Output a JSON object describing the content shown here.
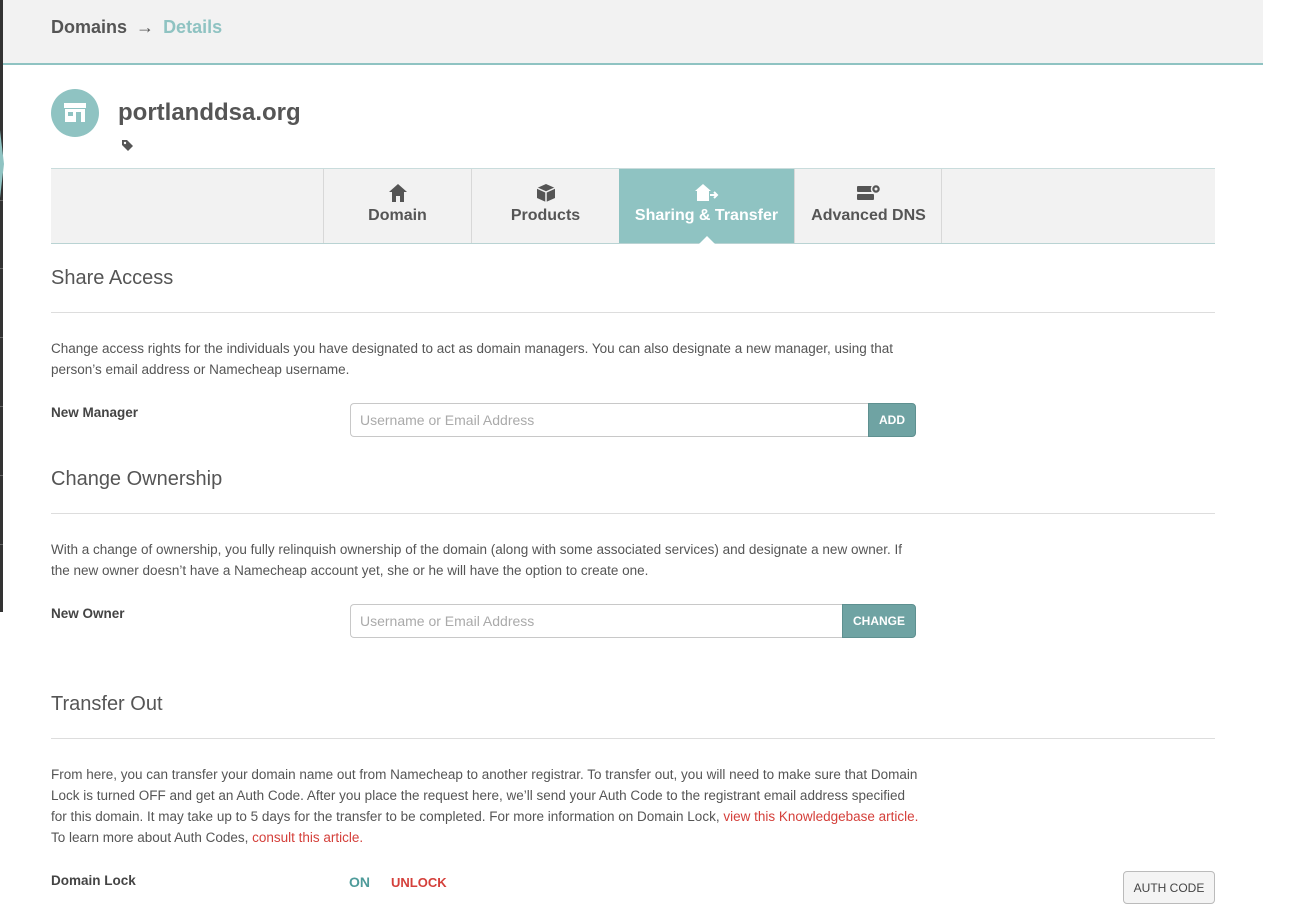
{
  "breadcrumb": {
    "root": "Domains",
    "arrow": "→",
    "current": "Details"
  },
  "domain": {
    "name": "portlanddsa.org"
  },
  "tabs": [
    {
      "label": "Domain",
      "icon": "house-icon",
      "active": false
    },
    {
      "label": "Products",
      "icon": "box-icon",
      "active": false
    },
    {
      "label": "Sharing & Transfer",
      "icon": "house-share-icon",
      "active": true
    },
    {
      "label": "Advanced DNS",
      "icon": "server-gear-icon",
      "active": false
    }
  ],
  "share_access": {
    "title": "Share Access",
    "description": "Change access rights for the individuals you have designated to act as domain managers. You can also designate a new manager, using that person’s email address or Namecheap username.",
    "field_label": "New Manager",
    "input_value": "",
    "input_placeholder": "Username or Email Address",
    "button_label": "ADD"
  },
  "change_ownership": {
    "title": "Change Ownership",
    "description": "With a change of ownership, you fully relinquish ownership of the domain (along with some associated services) and designate a new owner. If the new owner doesn’t have a Namecheap account yet, she or he will have the option to create one.",
    "field_label": "New Owner",
    "input_value": "",
    "input_placeholder": "Username or Email Address",
    "button_label": "CHANGE"
  },
  "transfer_out": {
    "title": "Transfer Out",
    "description_1": "From here, you can transfer your domain name out from Namecheap to another registrar. To transfer out, you will need to make sure that Domain Lock is turned OFF and get an Auth Code. After you place the request here, we’ll send your Auth Code to the registrant email address specified for this domain. It may take up to 5 days for the transfer to be completed. For more information on Domain Lock, ",
    "link_1": "view this Knowledgebase article.",
    "description_2": " To learn more about Auth Codes, ",
    "link_2": "consult this article.",
    "lock_label": "Domain Lock",
    "lock_status": "ON",
    "unlock_label": "UNLOCK",
    "auth_button": "AUTH CODE"
  },
  "colors": {
    "accent": "#8fc3c2",
    "button": "#6fa3a3",
    "link": "#d43f3a",
    "text": "#555555"
  }
}
